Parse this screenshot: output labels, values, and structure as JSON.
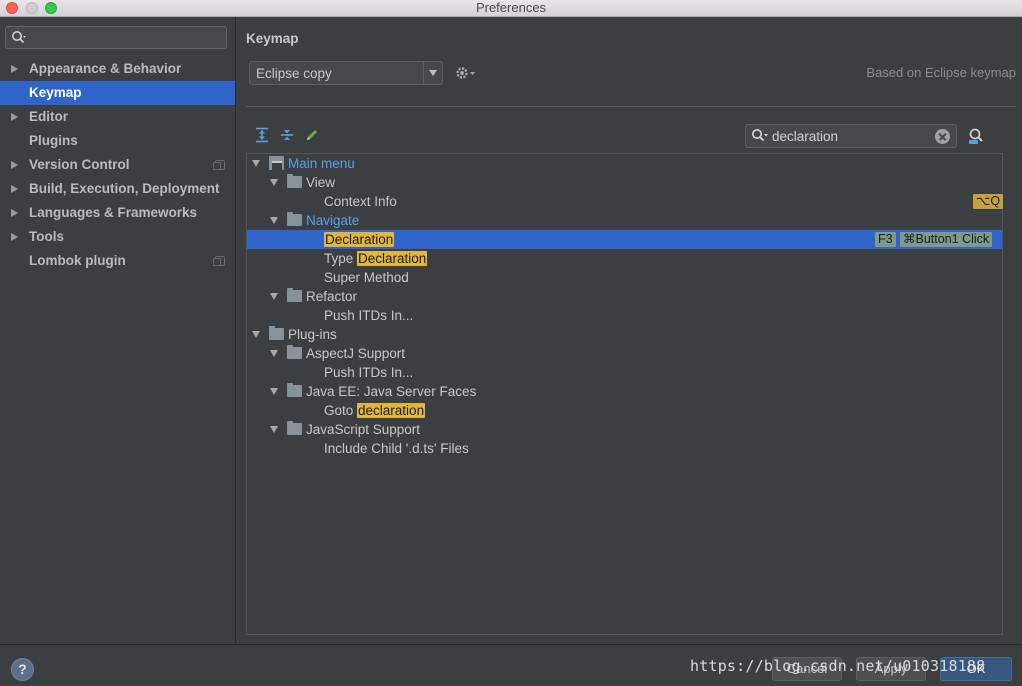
{
  "window": {
    "title": "Preferences"
  },
  "sidebar": {
    "search_placeholder": "",
    "items": [
      {
        "label": "Appearance & Behavior",
        "expandable": true,
        "selected": false,
        "copy": false
      },
      {
        "label": "Keymap",
        "expandable": false,
        "selected": true,
        "copy": false
      },
      {
        "label": "Editor",
        "expandable": true,
        "selected": false,
        "copy": false
      },
      {
        "label": "Plugins",
        "expandable": false,
        "selected": false,
        "copy": false
      },
      {
        "label": "Version Control",
        "expandable": true,
        "selected": false,
        "copy": true
      },
      {
        "label": "Build, Execution, Deployment",
        "expandable": true,
        "selected": false,
        "copy": false
      },
      {
        "label": "Languages & Frameworks",
        "expandable": true,
        "selected": false,
        "copy": false
      },
      {
        "label": "Tools",
        "expandable": true,
        "selected": false,
        "copy": false
      },
      {
        "label": "Lombok plugin",
        "expandable": false,
        "selected": false,
        "copy": true
      }
    ]
  },
  "keymap": {
    "heading": "Keymap",
    "scheme": "Eclipse copy",
    "based_on": "Based on Eclipse keymap",
    "search_value": "declaration"
  },
  "tree": {
    "rows": [
      {
        "text": "Main menu",
        "pre": "",
        "match": "",
        "post": "",
        "shortcuts": []
      },
      {
        "text": "View",
        "pre": "",
        "match": "",
        "post": "",
        "shortcuts": []
      },
      {
        "text": "Context Info",
        "pre": "",
        "match": "",
        "post": "",
        "shortcuts": [
          "⌥Q"
        ]
      },
      {
        "text": "Navigate",
        "pre": "",
        "match": "",
        "post": "",
        "shortcuts": []
      },
      {
        "text": "",
        "pre": "",
        "match": "Declaration",
        "post": "",
        "shortcuts": [
          "F3",
          "⌘Button1 Click"
        ]
      },
      {
        "text": "",
        "pre": "Type ",
        "match": "Declaration",
        "post": "",
        "shortcuts": []
      },
      {
        "text": "Super Method",
        "pre": "",
        "match": "",
        "post": "",
        "shortcuts": []
      },
      {
        "text": "Refactor",
        "pre": "",
        "match": "",
        "post": "",
        "shortcuts": []
      },
      {
        "text": "Push ITDs In...",
        "pre": "",
        "match": "",
        "post": "",
        "shortcuts": []
      },
      {
        "text": "Plug-ins",
        "pre": "",
        "match": "",
        "post": "",
        "shortcuts": []
      },
      {
        "text": "AspectJ Support",
        "pre": "",
        "match": "",
        "post": "",
        "shortcuts": []
      },
      {
        "text": "Push ITDs In...",
        "pre": "",
        "match": "",
        "post": "",
        "shortcuts": []
      },
      {
        "text": "Java EE: Java Server Faces",
        "pre": "",
        "match": "",
        "post": "",
        "shortcuts": []
      },
      {
        "text": "",
        "pre": "Goto ",
        "match": "declaration",
        "post": "",
        "shortcuts": []
      },
      {
        "text": "JavaScript Support",
        "pre": "",
        "match": "",
        "post": "",
        "shortcuts": []
      },
      {
        "text": "Include Child '.d.ts' Files",
        "pre": "",
        "match": "",
        "post": "",
        "shortcuts": []
      }
    ]
  },
  "footer": {
    "help": "?",
    "cancel": "Cancel",
    "apply": "Apply",
    "ok": "OK",
    "watermark": "https://blog.csdn.net/u010318188"
  },
  "colors": {
    "accent": "#2f65ca",
    "highlight": "#e2b53d",
    "link": "#5c9fe8"
  }
}
